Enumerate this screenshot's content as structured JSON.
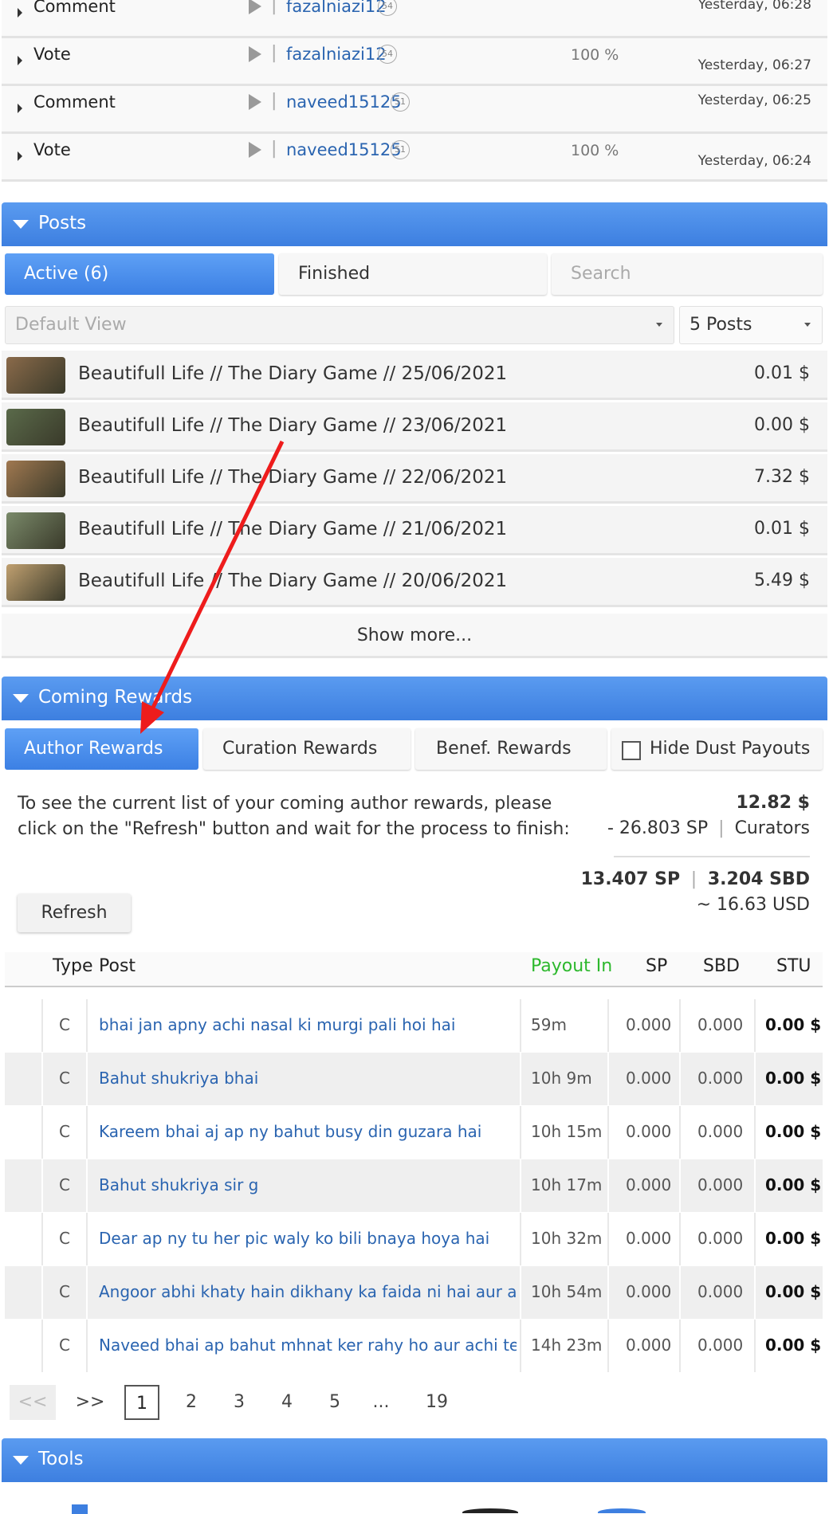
{
  "activity": [
    {
      "type": "Comment",
      "user": "fazalniazi12",
      "rep": "54",
      "pct": "",
      "time": "Yesterday, 06:28"
    },
    {
      "type": "Vote",
      "user": "fazalniazi12",
      "rep": "54",
      "pct": "100 %",
      "time": "Yesterday, 06:27"
    },
    {
      "type": "Comment",
      "user": "naveed15125",
      "rep": "51",
      "pct": "",
      "time": "Yesterday, 06:25"
    },
    {
      "type": "Vote",
      "user": "naveed15125",
      "rep": "51",
      "pct": "100 %",
      "time": "Yesterday, 06:24"
    }
  ],
  "posts": {
    "header": "Posts",
    "tab_active": "Active (6)",
    "tab_finished": "Finished",
    "search_placeholder": "Search",
    "view_select": "Default View",
    "count_select": "5 Posts",
    "items": [
      {
        "title": "Beautifull Life // The Diary Game // 25/06/2021",
        "value": "0.01 $",
        "thumb": "#8a6a4a"
      },
      {
        "title": "Beautifull Life // The Diary Game // 23/06/2021",
        "value": "0.00 $",
        "thumb": "#5a6a4a"
      },
      {
        "title": "Beautifull Life // The Diary Game // 22/06/2021",
        "value": "7.32 $",
        "thumb": "#a07850"
      },
      {
        "title": "Beautifull Life // The Diary Game // 21/06/2021",
        "value": "0.01 $",
        "thumb": "#7a8a6a"
      },
      {
        "title": "Beautifull Life // The Diary Game // 20/06/2021",
        "value": "5.49 $",
        "thumb": "#c0a070"
      }
    ],
    "show_more": "Show more..."
  },
  "rewards": {
    "header": "Coming Rewards",
    "tab_author": "Author Rewards",
    "tab_curation": "Curation Rewards",
    "tab_benef": "Benef. Rewards",
    "hide_dust": "Hide Dust Payouts",
    "info": "To see the current list of your coming author rewards, please click on the \"Refresh\" button and wait for the process to finish:",
    "refresh": "Refresh",
    "total_usd": "12.82 $",
    "curators_sp": "- 26.803 SP",
    "curators_label": "Curators",
    "net_sp": "13.407 SP",
    "net_sbd": "3.204 SBD",
    "approx_usd": "~ 16.63 USD",
    "columns": {
      "type": "Type",
      "post": "Post",
      "payout": "Payout In",
      "sp": "SP",
      "sbd": "SBD",
      "stu": "STU"
    },
    "rows": [
      {
        "type": "C",
        "post": "bhai jan apny achi nasal ki murgi pali hoi hai",
        "payout": "59m",
        "sp": "0.000",
        "sbd": "0.000",
        "stu": "0.00 $"
      },
      {
        "type": "C",
        "post": "Bahut shukriya bhai",
        "payout": "10h 9m",
        "sp": "0.000",
        "sbd": "0.000",
        "stu": "0.00 $"
      },
      {
        "type": "C",
        "post": "Kareem bhai aj ap ny bahut busy din guzara hai",
        "payout": "10h 15m",
        "sp": "0.000",
        "sbd": "0.000",
        "stu": "0.00 $"
      },
      {
        "type": "C",
        "post": "Bahut shukriya sir g",
        "payout": "10h 17m",
        "sp": "0.000",
        "sbd": "0.000",
        "stu": "0.00 $"
      },
      {
        "type": "C",
        "post": "Dear ap ny tu her pic waly ko bili bnaya hoya hai",
        "payout": "10h 32m",
        "sp": "0.000",
        "sbd": "0.000",
        "stu": "0.00 $"
      },
      {
        "type": "C",
        "post": "Angoor abhi khaty hain dikhany ka faida ni hai aur achi pic",
        "payout": "10h 54m",
        "sp": "0.000",
        "sbd": "0.000",
        "stu": "0.00 $"
      },
      {
        "type": "C",
        "post": "Naveed bhai ap bahut mhnat ker rahy ho aur achi tehre",
        "payout": "14h 23m",
        "sp": "0.000",
        "sbd": "0.000",
        "stu": "0.00 $"
      }
    ],
    "pagination": {
      "prev": "<<",
      "next": ">>",
      "pages": [
        "1",
        "2",
        "3",
        "4",
        "5",
        "...",
        "19"
      ]
    }
  },
  "tools": {
    "header": "Tools"
  },
  "colors": {
    "header_blue": "#3d7fe0",
    "link_blue": "#2a64b0",
    "payout_green": "#2db82d",
    "annotation_red": "#ee1c1c"
  }
}
